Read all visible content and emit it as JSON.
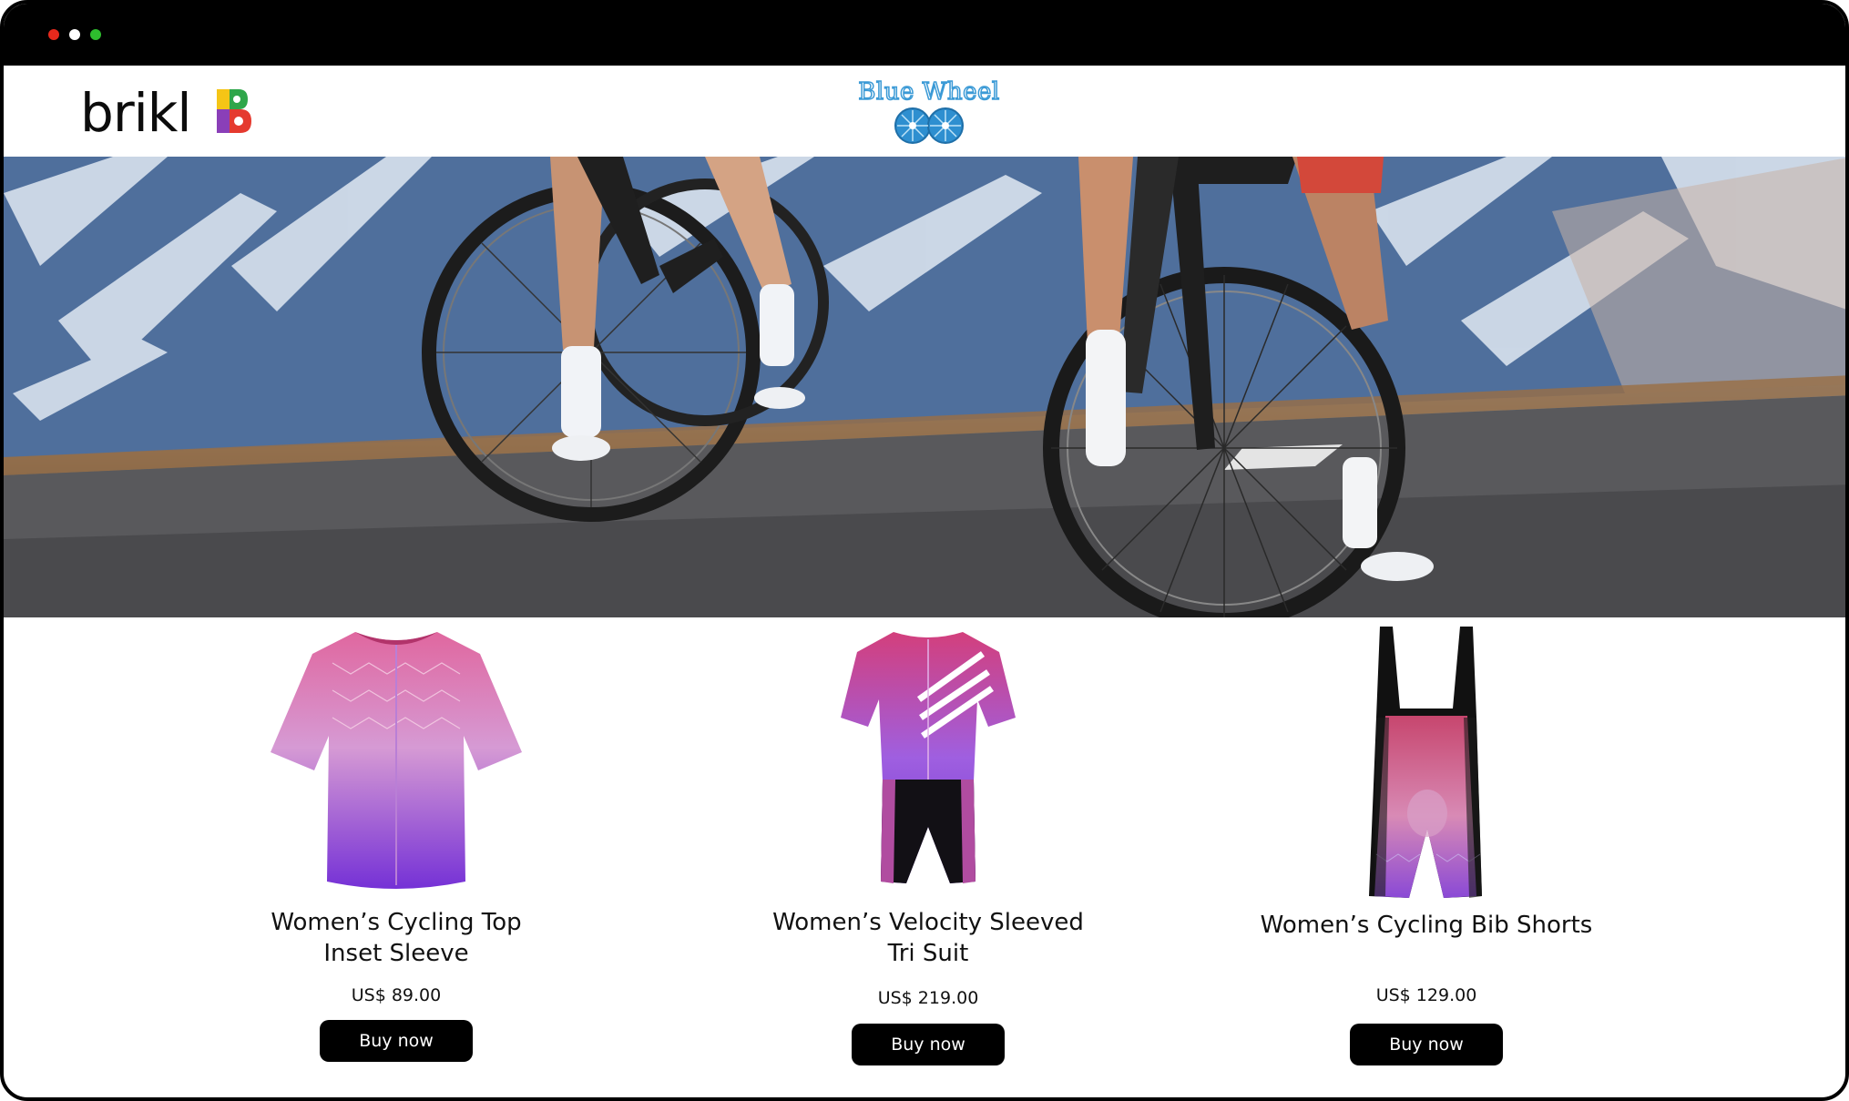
{
  "window": {
    "controls": [
      "close",
      "minimize",
      "maximize"
    ]
  },
  "header": {
    "brand_name": "brikl",
    "brand_mark_icon": "brikl-b-logo-icon",
    "store_logo_text": "Blue Wheel",
    "store_logo_icon": "blue-wheel-logo-icon"
  },
  "hero": {
    "image": "cyclists-with-road-bikes-mountain-road"
  },
  "products": [
    {
      "name_line1": "Women’s Cycling Top",
      "name_line2": "Inset Sleeve",
      "price": "US$ 89.00",
      "button": "Buy now",
      "image_icon": "cycling-jersey-icon"
    },
    {
      "name_line1": "Women’s Velocity Sleeved",
      "name_line2": "Tri Suit",
      "price": "US$ 219.00",
      "button": "Buy now",
      "image_icon": "tri-suit-icon"
    },
    {
      "name_line1": "Women’s Cycling Bib Shorts",
      "name_line2": "",
      "price": "US$ 129.00",
      "button": "Buy now",
      "image_icon": "bib-shorts-icon"
    }
  ],
  "colors": {
    "frame": "#000000",
    "button_bg": "#000000",
    "button_text": "#ffffff",
    "product_pink": "#d85a9a",
    "product_purple": "#7b3ad8",
    "logo_blue": "#3b9ad6"
  }
}
